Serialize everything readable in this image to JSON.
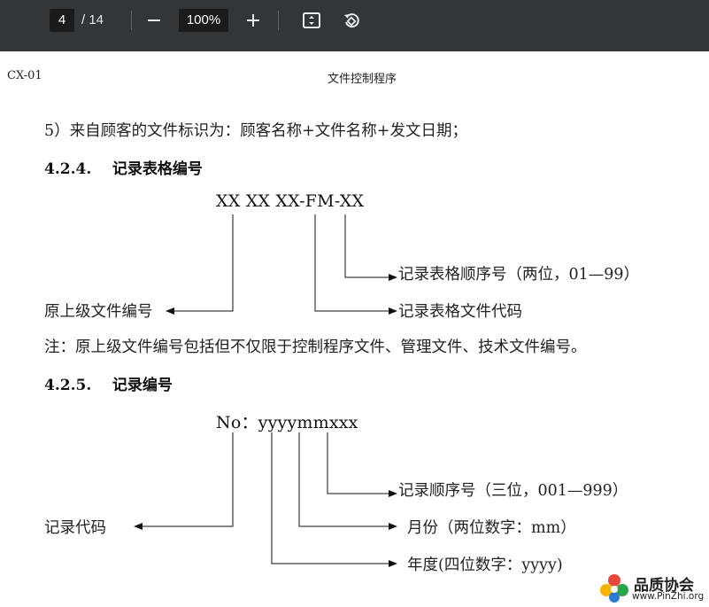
{
  "toolbar": {
    "current_page": "4",
    "total_pages": "/ 14",
    "zoom": "100%",
    "icons": {
      "zoom_out": "minus-icon",
      "zoom_in": "plus-icon",
      "fit": "fit-page-icon",
      "rotate": "rotate-icon"
    }
  },
  "page": {
    "header_left": "CX-01",
    "header_center": "文件控制程序",
    "item5": "5）来自顾客的文件标识为：顾客名称+文件名称+发文日期；",
    "section_424": {
      "title": "4.2.4.    记录表格编号",
      "code": "XX XX XX-FM-XX",
      "label_sequence": "记录表格顺序号（两位，01—99）",
      "label_original": "原上级文件编号",
      "label_form_code": "记录表格文件代码"
    },
    "note": "注：原上级文件编号包括但不仅限于控制程序文件、管理文件、技术文件编号。",
    "section_425": {
      "title": "4.2.5.    记录编号",
      "code": "No：yyyymmxxx",
      "label_sequence": "记录顺序号（三位，001—999）",
      "label_record_code": "记录代码",
      "label_month": "月份（两位数字：mm）",
      "label_year": "年度(四位数字：yyyy)"
    }
  },
  "watermark": {
    "title": "品质协会",
    "url": "www.PinZhi.org"
  }
}
